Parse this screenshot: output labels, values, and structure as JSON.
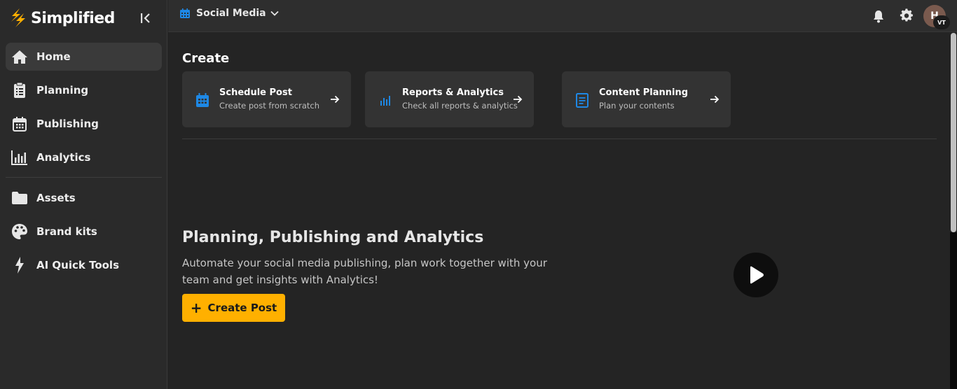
{
  "brand": {
    "name": "Simplified"
  },
  "sidebar": {
    "items": [
      {
        "label": "Home",
        "icon": "home-icon",
        "active": true
      },
      {
        "label": "Planning",
        "icon": "clipboard-icon"
      },
      {
        "label": "Publishing",
        "icon": "calendar-icon"
      },
      {
        "label": "Analytics",
        "icon": "bar-chart-icon"
      }
    ],
    "secondary_items": [
      {
        "label": "Assets",
        "icon": "folder-icon"
      },
      {
        "label": "Brand kits",
        "icon": "palette-icon"
      },
      {
        "label": "AI Quick Tools",
        "icon": "lightning-icon"
      }
    ]
  },
  "header": {
    "workspace": "Social Media",
    "avatar_initial": "H",
    "avatar_badge": "VT"
  },
  "main": {
    "create_title": "Create",
    "cards": [
      {
        "title": "Schedule Post",
        "subtitle": "Create post from scratch",
        "icon": "calendar-icon"
      },
      {
        "title": "Reports & Analytics",
        "subtitle": "Check all reports & analytics",
        "icon": "bar-chart-icon"
      },
      {
        "title": "Content Planning",
        "subtitle": "Plan your contents",
        "icon": "document-icon"
      }
    ],
    "hero": {
      "title": "Planning, Publishing and Analytics",
      "description": "Automate your social media publishing, plan work together with your team and get insights with Analytics!",
      "button_label": "Create Post"
    }
  },
  "colors": {
    "accent": "#ffb000",
    "icon_blue": "#1e88e5",
    "background": "#242424",
    "sidebar": "#2a2a2a",
    "card": "#333333"
  }
}
